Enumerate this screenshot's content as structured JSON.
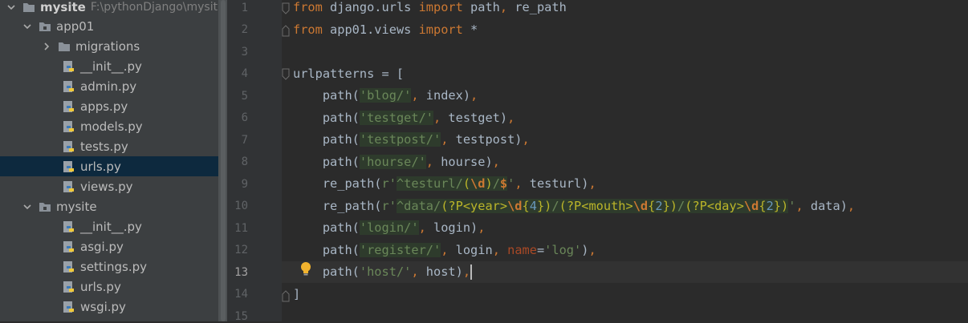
{
  "sidebar": {
    "root": {
      "label": "mysite",
      "path": "F:\\pythonDjango\\mysite"
    },
    "items": [
      {
        "label": "app01"
      },
      {
        "label": "migrations"
      },
      {
        "label": "__init__.py"
      },
      {
        "label": "admin.py"
      },
      {
        "label": "apps.py"
      },
      {
        "label": "models.py"
      },
      {
        "label": "tests.py"
      },
      {
        "label": "urls.py"
      },
      {
        "label": "views.py"
      },
      {
        "label": "mysite"
      },
      {
        "label": "__init__.py"
      },
      {
        "label": "asgi.py"
      },
      {
        "label": "settings.py"
      },
      {
        "label": "urls.py"
      },
      {
        "label": "wsgi.py"
      }
    ],
    "selected_index": 7
  },
  "editor": {
    "current_line": 13,
    "line_numbers": [
      "1",
      "2",
      "3",
      "4",
      "5",
      "6",
      "7",
      "8",
      "9",
      "10",
      "11",
      "12",
      "13",
      "14",
      "15"
    ],
    "lines": {
      "l1": [
        "from",
        " django.urls ",
        "import",
        " path",
        ",",
        " re_path"
      ],
      "l2": [
        "from",
        " app01.views ",
        "import",
        " *"
      ],
      "l4": [
        "urlpatterns = ["
      ],
      "l5": [
        "    path(",
        "'blog/'",
        ", ",
        "index)",
        ","
      ],
      "l6": [
        "    path(",
        "'testget/'",
        ", ",
        "testget)",
        ","
      ],
      "l7": [
        "    path(",
        "'testpost/'",
        ", ",
        "testpost)",
        ","
      ],
      "l8": [
        "    path(",
        "'hourse/'",
        ", ",
        "hourse)",
        ","
      ],
      "l9": [
        "    re_path(",
        "r'",
        "^testurl/",
        "(",
        "\\d",
        ")",
        "/",
        "$",
        "'",
        ", ",
        "testurl)",
        ","
      ],
      "l10": [
        "    re_path(",
        "r'",
        "^data/",
        "(?P<year>",
        "\\d",
        "{",
        "4",
        "}",
        ")",
        "/",
        "(?P<mouth>",
        "\\d",
        "{",
        "2",
        "}",
        ")",
        "/",
        "(?P<day>",
        "\\d",
        "{",
        "2",
        "}",
        ")",
        "'",
        ", ",
        "data)",
        ","
      ],
      "l11": [
        "    path(",
        "'login/'",
        ", ",
        "login)",
        ","
      ],
      "l12": [
        "    path(",
        "'register/'",
        ", ",
        "login",
        ", ",
        "name",
        "=",
        "'log'",
        ")",
        ","
      ],
      "l13": [
        "    path(",
        "'host/'",
        ", ",
        "host)",
        ","
      ],
      "l14": [
        "]"
      ]
    }
  },
  "colors": {
    "keyword": "#cc7832",
    "string": "#6a8759",
    "default": "#a9b7c6",
    "param": "#aa4926",
    "selection": "#0d293e"
  },
  "icons": {
    "expand": "chevron-down-icon",
    "collapse": "chevron-right-icon",
    "folder": "folder-icon",
    "python_file": "python-file-icon",
    "intention": "lightbulb-icon"
  }
}
